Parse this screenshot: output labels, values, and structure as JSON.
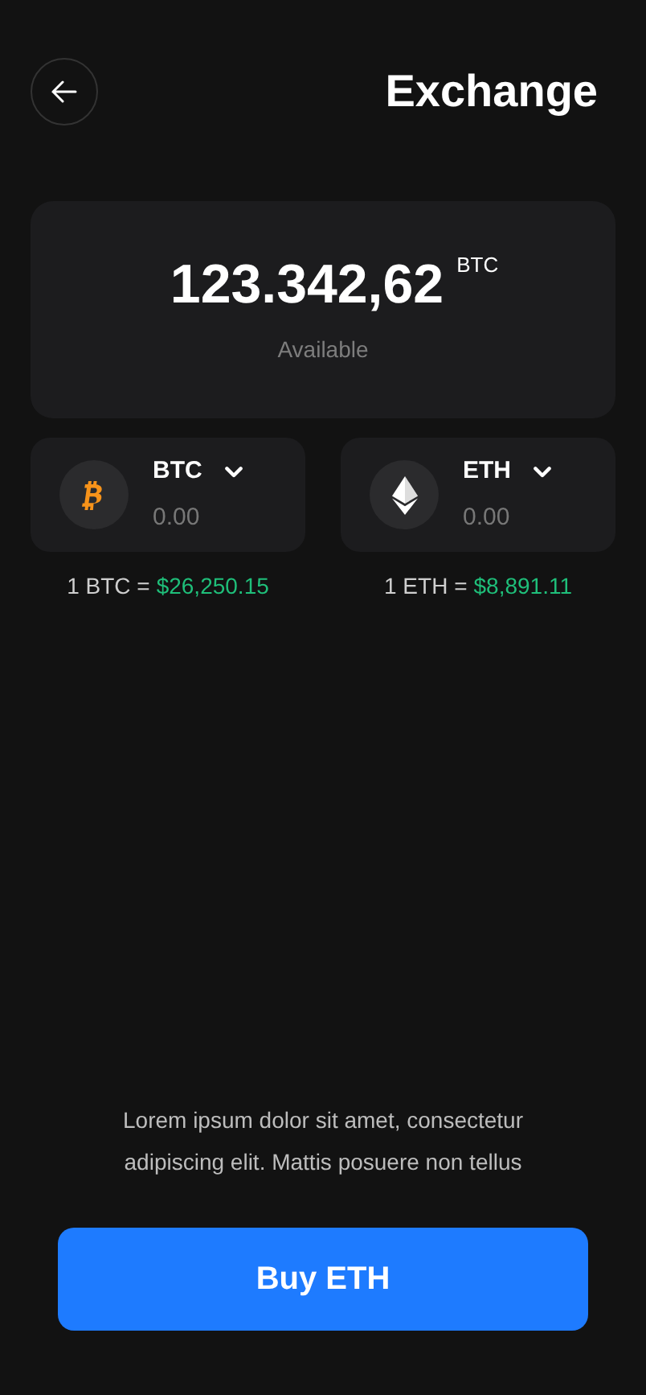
{
  "header": {
    "title": "Exchange"
  },
  "balance": {
    "amount": "123.342,62",
    "unit": "BTC",
    "label": "Available"
  },
  "coins": [
    {
      "kind": "btc",
      "symbol": "BTC",
      "amount": "0.00",
      "rate_label": "1 BTC =",
      "rate_value": "$26,250.15"
    },
    {
      "kind": "eth",
      "symbol": "ETH",
      "amount": "0.00",
      "rate_label": "1 ETH =",
      "rate_value": "$8,891.11"
    }
  ],
  "note": "Lorem ipsum dolor sit amet, consectetur adipiscing elit. Mattis posuere non tellus",
  "buy_button": "Buy ETH"
}
